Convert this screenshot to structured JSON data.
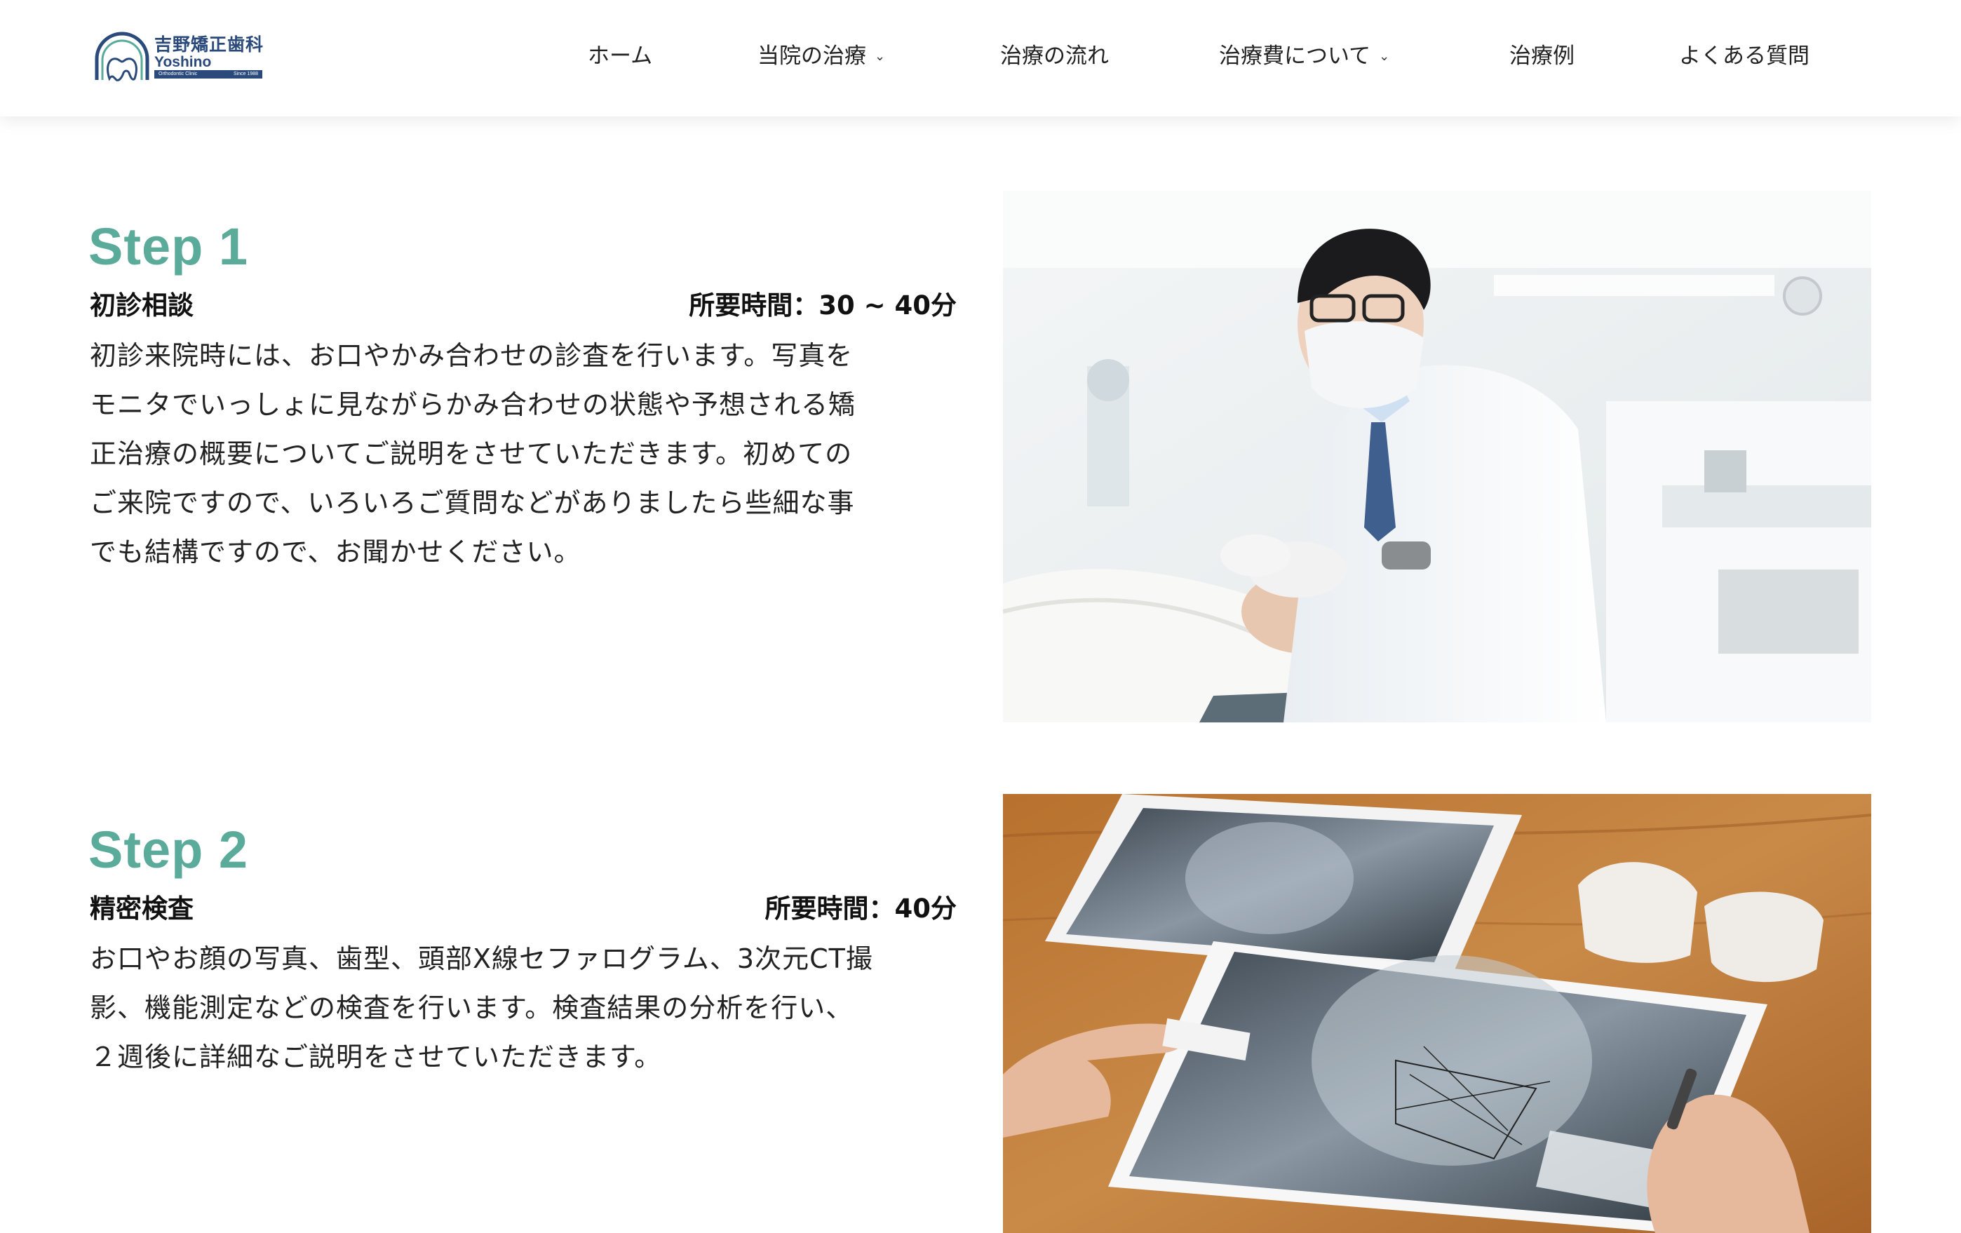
{
  "header": {
    "logo": {
      "name_jp": "吉野矯正歯科",
      "name_en": "Yoshino",
      "tagline": "Orthodontic Clinic",
      "since": "Since 1988"
    },
    "nav": [
      {
        "label": "ホーム",
        "dropdown": false
      },
      {
        "label": "当院の治療",
        "dropdown": true
      },
      {
        "label": "治療の流れ",
        "dropdown": false
      },
      {
        "label": "治療費について",
        "dropdown": true
      },
      {
        "label": "治療例",
        "dropdown": false
      },
      {
        "label": "よくある質問",
        "dropdown": false
      }
    ],
    "chevron_icon": "chevron-down-icon"
  },
  "steps": [
    {
      "title": "Step 1",
      "name": "初診相談",
      "duration": "所要時間：30 ~ 40分",
      "body_lines": [
        "初診来院時には、お口やかみ合わせの診査を行います。写真を",
        "モニタでいっしょに見ながらかみ合わせの状態や予想される矯",
        "正治療の概要についてご説明をさせていただきます。初めての",
        "ご来院ですので、いろいろご質問などがありましたら些細な事",
        "でも結構ですので、お聞かせください。"
      ],
      "image": "dentist-examining-patient-photo"
    },
    {
      "title": "Step 2",
      "name": "精密検査",
      "duration": "所要時間：40分",
      "body_lines": [
        "お口やお顔の写真、歯型、頭部X線セファログラム、3次元CT撮",
        "影、機能測定などの検査を行います。検査結果の分析を行い、",
        "２週後に詳細なご説明をさせていただきます。"
      ],
      "image": "cephalometric-xray-analysis-photo"
    }
  ],
  "colors": {
    "accent": "#5aab9a",
    "logo_navy": "#2a4a7c",
    "text": "#222222"
  }
}
